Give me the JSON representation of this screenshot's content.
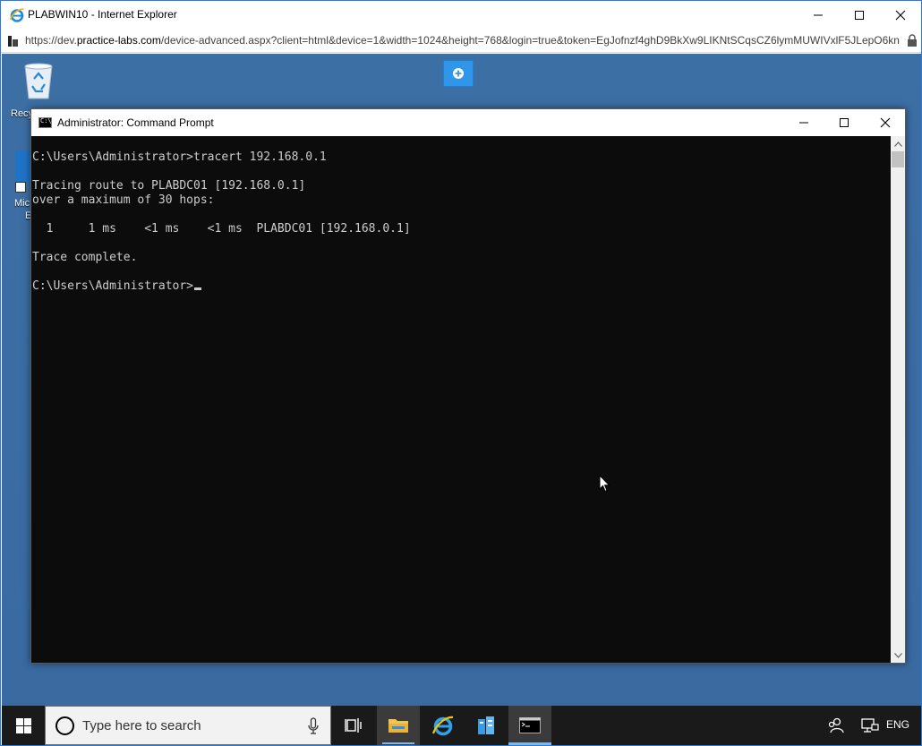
{
  "browser": {
    "window_title": "PLABWIN10 - Internet Explorer",
    "url_prefix": "https://dev.",
    "url_host": "practice-labs.com",
    "url_rest": "/device-advanced.aspx?client=html&device=1&width=1024&height=768&login=true&token=EgJofnzf4ghD9BkXw9LIKNtSCqsCZ6lymMUWIVxlF5JLepO6kn"
  },
  "desktop": {
    "recycle_bin_label": "Recy",
    "edge_label_line1": "Mic",
    "edge_label_line2": "E"
  },
  "cmd": {
    "title": "Administrator: Command Prompt",
    "lines": [
      "C:\\Users\\Administrator>tracert 192.168.0.1",
      "",
      "Tracing route to PLABDC01 [192.168.0.1]",
      "over a maximum of 30 hops:",
      "",
      "  1     1 ms    <1 ms    <1 ms  PLABDC01 [192.168.0.1]",
      "",
      "Trace complete.",
      ""
    ],
    "prompt": "C:\\Users\\Administrator>"
  },
  "taskbar": {
    "search_placeholder": "Type here to search",
    "language": "ENG"
  },
  "colors": {
    "desktop_bg": "#3a6ea5",
    "console_bg": "#0c0c0c",
    "console_text": "#cccccc",
    "taskbar_bg": "#1a1a1a",
    "accent": "#2f96ea"
  }
}
